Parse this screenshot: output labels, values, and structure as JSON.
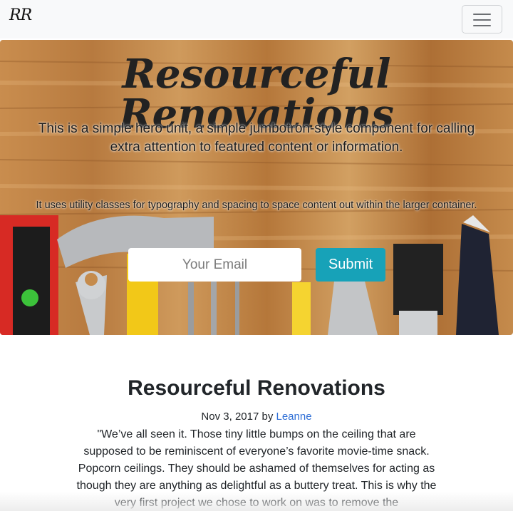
{
  "navbar": {
    "brand": "RR",
    "toggle_icon": "hamburger-menu-icon"
  },
  "hero": {
    "title": "Resourceful Renovations",
    "lead": "This is a simple hero unit, a simple jumbotron-style component for calling extra attention to featured content or information.",
    "sub": "It uses utility classes for typography and spacing to space content out within the larger container.",
    "email_placeholder": "Your Email",
    "submit_label": "Submit",
    "accent_color": "#17a2b8"
  },
  "article": {
    "title": "Resourceful Renovations",
    "date": "Nov 3, 2017",
    "by": "by",
    "author": "Leanne",
    "body": "\"We’ve all seen it. Those tiny little bumps on the ceiling that are supposed to be reminiscent of everyone’s favorite movie-time snack. Popcorn ceilings. They should be ashamed of themselves for acting as though they are anything as delightful as a buttery treat. This is why the very first project we chose to work on was to remove the"
  }
}
